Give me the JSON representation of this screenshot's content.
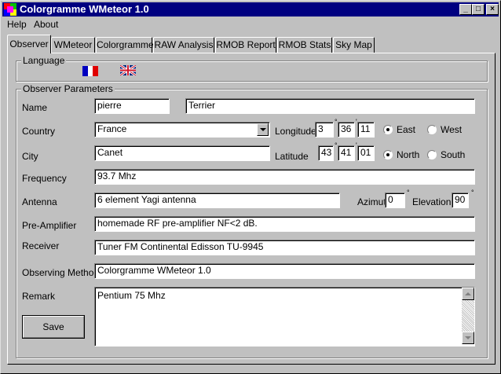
{
  "window": {
    "title": "Colorgramme WMeteor 1.0",
    "controls": [
      "_",
      "□",
      "×"
    ]
  },
  "menu": [
    {
      "label": "Help"
    },
    {
      "label": "About"
    }
  ],
  "tabs": [
    {
      "label": "Observer"
    },
    {
      "label": "WMeteor"
    },
    {
      "label": "Colorgramme"
    },
    {
      "label": "RAW Analysis"
    },
    {
      "label": "RMOB Report"
    },
    {
      "label": "RMOB Stats"
    },
    {
      "label": "Sky Map"
    }
  ],
  "language": {
    "group_label": "Language",
    "options": [
      "french-flag-icon",
      "uk-flag-icon"
    ]
  },
  "observer": {
    "group_label": "Observer Parameters",
    "name_label": "Name",
    "first_name": "pierre",
    "last_name": "Terrier",
    "country_label": "Country",
    "country": "France",
    "longitude_label": "Longitude",
    "lon_deg": "3",
    "lon_min": "36",
    "lon_sec": "11",
    "east_label": "East",
    "west_label": "West",
    "city_label": "City",
    "city": "Canet",
    "latitude_label": "Latitude",
    "lat_deg": "43",
    "lat_min": "41",
    "lat_sec": "01",
    "north_label": "North",
    "south_label": "South",
    "degree_sign": "°",
    "minute_sign": "'",
    "frequency_label": "Frequency",
    "frequency": "93.7 Mhz",
    "antenna_label": "Antenna",
    "antenna": "6 element Yagi antenna",
    "azimut_label": "Azimut",
    "azimut": "0",
    "elevation_label": "Elevation",
    "elevation": "90",
    "preamp_label": "Pre-Amplifier",
    "preamp": "homemade RF pre-amplifier NF<2 dB.",
    "receiver_label": "Receiver",
    "receiver": "Tuner FM Continental Edisson TU-9945",
    "method_label": "Observing Method",
    "method": "Colorgramme  WMeteor 1.0",
    "remark_label": "Remark",
    "remark": "Pentium 75 Mhz",
    "save_label": "Save"
  },
  "colors": {
    "title_bar": "#000080",
    "face": "#c0c0c0"
  }
}
